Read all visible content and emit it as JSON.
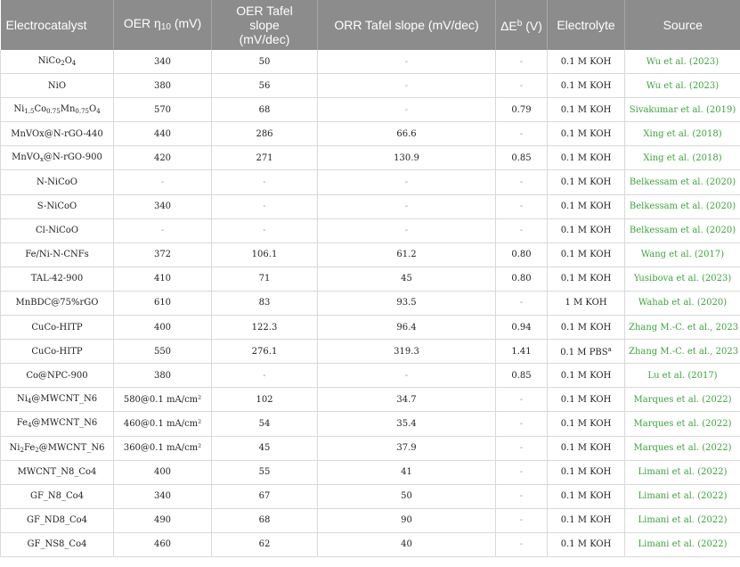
{
  "columns": [
    {
      "label": "Electrocatalyst"
    },
    {
      "label": "OER η",
      "sub": "10",
      "suffix": " (mV)"
    },
    {
      "label": "OER Tafel slope (mV/dec)"
    },
    {
      "label": "ORR Tafel slope (mV/dec)"
    },
    {
      "label": "ΔE",
      "sup": "b",
      "suffix": " (V)"
    },
    {
      "label": "Electrolyte"
    },
    {
      "label": "Source"
    }
  ],
  "rows": [
    {
      "cells": [
        {
          "t": "NiCo",
          "s": "2"
        },
        {
          "t": "O",
          "s": "4"
        }
      ],
      "oer": "340",
      "oer_tafel": "50",
      "orr_tafel": "-",
      "de": "-",
      "electrolyte": [
        {
          "t": "0.1 M KOH"
        }
      ],
      "source": "Wu et al. (2023)"
    },
    {
      "cells": [
        {
          "t": "NiO"
        }
      ],
      "oer": "380",
      "oer_tafel": "56",
      "orr_tafel": "-",
      "de": "-",
      "electrolyte": [
        {
          "t": "0.1 M KOH"
        }
      ],
      "source": "Wu et al. (2023)"
    },
    {
      "cells": [
        {
          "t": "Ni",
          "s": "1.5"
        },
        {
          "t": "Co",
          "s": "0.75"
        },
        {
          "t": "Mn",
          "s": "0.75"
        },
        {
          "t": "O",
          "s": "4"
        }
      ],
      "oer": "570",
      "oer_tafel": "68",
      "orr_tafel": "-",
      "de": "0.79",
      "electrolyte": [
        {
          "t": "0.1 M KOH"
        }
      ],
      "source": "Sivakumar et al. (2019)"
    },
    {
      "cells": [
        {
          "t": "MnVOx@N-rGO-440"
        }
      ],
      "oer": "440",
      "oer_tafel": "286",
      "orr_tafel": "66.6",
      "de": "-",
      "electrolyte": [
        {
          "t": "0.1 M KOH"
        }
      ],
      "source": "Xing et al. (2018)"
    },
    {
      "cells": [
        {
          "t": "MnVO",
          "s": "x"
        },
        {
          "t": "@N-rGO-900"
        }
      ],
      "oer": "420",
      "oer_tafel": "271",
      "orr_tafel": "130.9",
      "de": "0.85",
      "electrolyte": [
        {
          "t": "0.1 M KOH"
        }
      ],
      "source": "Xing et al. (2018)"
    },
    {
      "cells": [
        {
          "t": "N-NiCoO"
        }
      ],
      "oer": "-",
      "oer_tafel": "-",
      "orr_tafel": "-",
      "de": "-",
      "electrolyte": [
        {
          "t": "0.1 M KOH"
        }
      ],
      "source": "Belkessam et al. (2020)"
    },
    {
      "cells": [
        {
          "t": "S-NiCoO"
        }
      ],
      "oer": "340",
      "oer_tafel": "-",
      "orr_tafel": "-",
      "de": "-",
      "electrolyte": [
        {
          "t": "0.1 M KOH"
        }
      ],
      "source": "Belkessam et al. (2020)"
    },
    {
      "cells": [
        {
          "t": "Cl-NiCoO"
        }
      ],
      "oer": "-",
      "oer_tafel": "-",
      "orr_tafel": "-",
      "de": "-",
      "electrolyte": [
        {
          "t": "0.1 M KOH"
        }
      ],
      "source": "Belkessam et al. (2020)"
    },
    {
      "cells": [
        {
          "t": "Fe/Ni-N-CNFs"
        }
      ],
      "oer": "372",
      "oer_tafel": "106.1",
      "orr_tafel": "61.2",
      "de": "0.80",
      "electrolyte": [
        {
          "t": "0.1 M KOH"
        }
      ],
      "source": "Wang et al. (2017)"
    },
    {
      "cells": [
        {
          "t": "TAL-42-900"
        }
      ],
      "oer": "410",
      "oer_tafel": "71",
      "orr_tafel": "45",
      "de": "0.80",
      "electrolyte": [
        {
          "t": "0.1 M KOH"
        }
      ],
      "source": "Yusibova et al. (2023)"
    },
    {
      "cells": [
        {
          "t": "MnBDC@75%rGO"
        }
      ],
      "oer": "610",
      "oer_tafel": "83",
      "orr_tafel": "93.5",
      "de": "-",
      "electrolyte": [
        {
          "t": "1 M KOH"
        }
      ],
      "source": "Wahab et al. (2020)"
    },
    {
      "cells": [
        {
          "t": "CuCo-HITP"
        }
      ],
      "oer": "400",
      "oer_tafel": "122.3",
      "orr_tafel": "96.4",
      "de": "0.94",
      "electrolyte": [
        {
          "t": "0.1 M KOH"
        }
      ],
      "source": "Zhang M.-C. et al., 2023"
    },
    {
      "cells": [
        {
          "t": "CuCo-HITP"
        }
      ],
      "oer": "550",
      "oer_tafel": "276.1",
      "orr_tafel": "319.3",
      "de": "1.41",
      "electrolyte": [
        {
          "t": "0.1 M PBS"
        },
        {
          "t": "",
          "p": "a"
        }
      ],
      "source": "Zhang M.-C. et al., 2023"
    },
    {
      "cells": [
        {
          "t": "Co@NPC-900"
        }
      ],
      "oer": "380",
      "oer_tafel": "-",
      "orr_tafel": "-",
      "de": "0.85",
      "electrolyte": [
        {
          "t": "0.1 M KOH"
        }
      ],
      "source": "Lu et al. (2017)"
    },
    {
      "cells": [
        {
          "t": "Ni",
          "s": "4"
        },
        {
          "t": "@MWCNT_N6"
        }
      ],
      "oer": "580@0.1 mA/cm²",
      "oer_tafel": "102",
      "orr_tafel": "34.7",
      "de": "-",
      "electrolyte": [
        {
          "t": "0.1 M KOH"
        }
      ],
      "source": "Marques et al. (2022)"
    },
    {
      "cells": [
        {
          "t": "Fe",
          "s": "4"
        },
        {
          "t": "@MWCNT_N6"
        }
      ],
      "oer": "460@0.1 mA/cm²",
      "oer_tafel": "54",
      "orr_tafel": "35.4",
      "de": "-",
      "electrolyte": [
        {
          "t": "0.1 M KOH"
        }
      ],
      "source": "Marques et al. (2022)"
    },
    {
      "cells": [
        {
          "t": "Ni",
          "s": "2"
        },
        {
          "t": "Fe",
          "s": "2"
        },
        {
          "t": "@MWCNT_N6"
        }
      ],
      "oer": "360@0.1 mA/cm²",
      "oer_tafel": "45",
      "orr_tafel": "37.9",
      "de": "-",
      "electrolyte": [
        {
          "t": "0.1 M KOH"
        }
      ],
      "source": "Marques et al. (2022)"
    },
    {
      "cells": [
        {
          "t": "MWCNT_N8_Co4"
        }
      ],
      "oer": "400",
      "oer_tafel": "55",
      "orr_tafel": "41",
      "de": "-",
      "electrolyte": [
        {
          "t": "0.1 M KOH"
        }
      ],
      "source": "Limani et al. (2022)"
    },
    {
      "cells": [
        {
          "t": "GF_N8_Co4"
        }
      ],
      "oer": "340",
      "oer_tafel": "67",
      "orr_tafel": "50",
      "de": "-",
      "electrolyte": [
        {
          "t": "0.1 M KOH"
        }
      ],
      "source": "Limani et al. (2022)"
    },
    {
      "cells": [
        {
          "t": "GF_ND8_Co4"
        }
      ],
      "oer": "490",
      "oer_tafel": "68",
      "orr_tafel": "90",
      "de": "-",
      "electrolyte": [
        {
          "t": "0.1 M KOH"
        }
      ],
      "source": "Limani et al. (2022)"
    },
    {
      "cells": [
        {
          "t": "GF_NS8_Co4"
        }
      ],
      "oer": "460",
      "oer_tafel": "62",
      "orr_tafel": "40",
      "de": "-",
      "electrolyte": [
        {
          "t": "0.1 M KOH"
        }
      ],
      "source": "Limani et al. (2022)"
    }
  ]
}
